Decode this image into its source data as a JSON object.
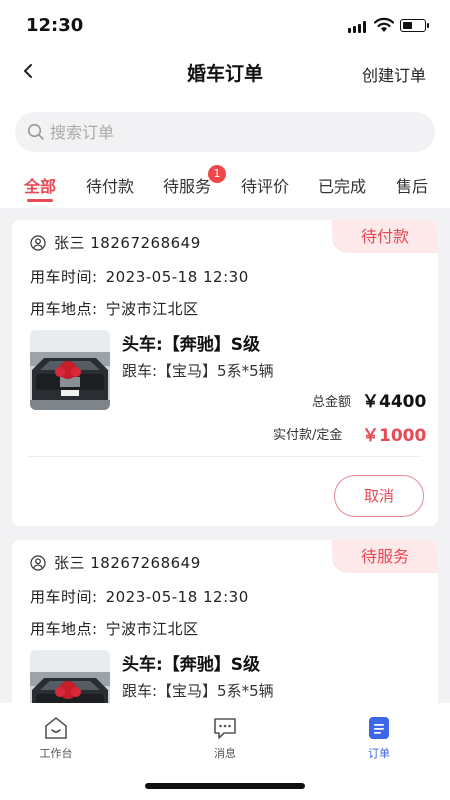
{
  "status_bar": {
    "time": "12:30",
    "battery_level": 0.45
  },
  "nav": {
    "title": "婚车订单",
    "action": "创建订单",
    "back_icon": "chevron-left-icon"
  },
  "search": {
    "placeholder": "搜索订单",
    "value": ""
  },
  "tabs": [
    {
      "label": "全部",
      "active": true
    },
    {
      "label": "待付款",
      "active": false
    },
    {
      "label": "待服务",
      "active": false,
      "badge": "1"
    },
    {
      "label": "待评价",
      "active": false
    },
    {
      "label": "已完成",
      "active": false
    },
    {
      "label": "售后",
      "active": false
    }
  ],
  "orders": [
    {
      "status": "待付款",
      "customer": "张三 18267268649",
      "time_label": "用车时间:",
      "time": "2023-05-18 12:30",
      "place_label": "用车地点:",
      "place": "宁波市江北区",
      "lead_car": "头车:【奔驰】S级",
      "follow_cars": "跟车:【宝马】5系*5辆",
      "total_label": "总金额",
      "total": "￥4400",
      "paid_label": "实付款/定金",
      "paid": "￥1000",
      "action": "取消"
    },
    {
      "status": "待服务",
      "customer": "张三 18267268649",
      "time_label": "用车时间:",
      "time": "2023-05-18 12:30",
      "place_label": "用车地点:",
      "place": "宁波市江北区",
      "lead_car": "头车:【奔驰】S级",
      "follow_cars": "跟车:【宝马】5系*5辆"
    }
  ],
  "bottom_nav": [
    {
      "label": "工作台",
      "icon": "workbench-icon",
      "active": false
    },
    {
      "label": "消息",
      "icon": "message-icon",
      "active": false
    },
    {
      "label": "订单",
      "icon": "order-icon",
      "active": true
    }
  ],
  "colors": {
    "accent": "#e84a55",
    "tag_bg": "#fde8ea",
    "nav_active": "#3b67e8"
  }
}
